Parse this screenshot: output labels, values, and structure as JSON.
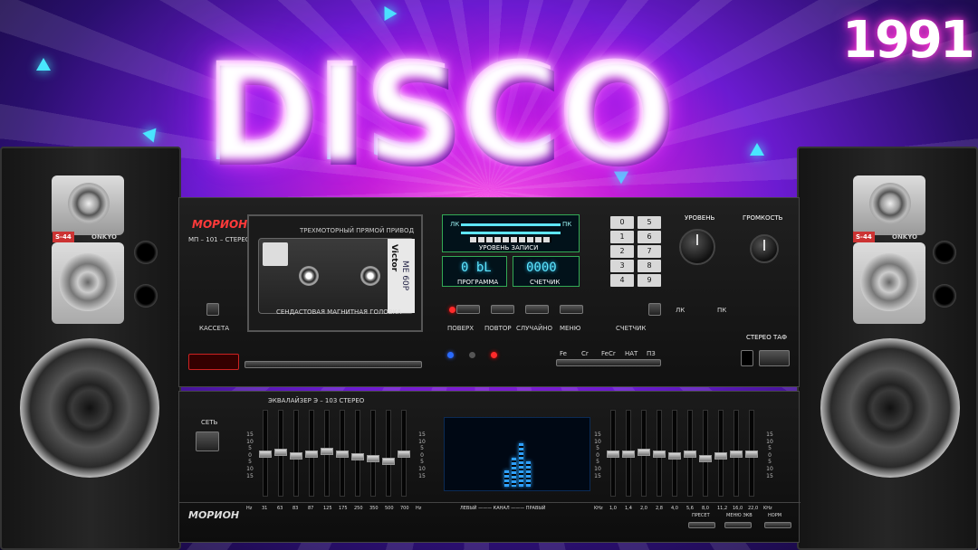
{
  "logo": {
    "text": "1991"
  },
  "headline": {
    "title": "DISCO"
  },
  "deck": {
    "brand": "МОРИОН",
    "model": "МП – 101 – СТЕРЕО",
    "cassette_label": "КАССЕТА",
    "tape_top": "ТРЕХМОТОРНЫЙ ПРЯМОЙ ПРИВОД",
    "cassette_brand": "Victor",
    "cassette_type": "ME 60P",
    "tape_bottom": "СЕНДАСТОВАЯ  МАГНИТНАЯ  ГОЛОВКА",
    "meter_l": "ЛК",
    "meter_r": "ПК",
    "meter_caption": "УРОВЕНЬ ЗАПИСИ",
    "program_value": "0 bL",
    "program_label": "ПРОГРАММА",
    "counter_value": "0000",
    "counter_label": "СЧЕТЧИК",
    "keys": [
      "0",
      "5",
      "1",
      "6",
      "2",
      "7",
      "3",
      "8",
      "4",
      "9"
    ],
    "transport": [
      "ПОВЕРХ",
      "ПОВТОР",
      "СЛУЧАЙНО",
      "МЕНЮ"
    ],
    "counter_btn": "СЧЕТЧИК",
    "level_label": "УРОВЕНЬ",
    "volume_label": "ГРОМКОСТЬ",
    "level_l": "ЛК",
    "level_r": "ПК",
    "stereo": "СТЕРЕО ТАФ",
    "tape_types": [
      "Fe",
      "Cr",
      "FeCr",
      "НАТ",
      "ПЗ"
    ]
  },
  "eq": {
    "title": "ЭКВАЛАЙЗЕР     Э – 103     СТЕРЕО",
    "power": "СЕТЬ",
    "brand": "МОРИОН",
    "scale": [
      "15",
      "10",
      "5",
      "0",
      "5",
      "10",
      "15"
    ],
    "hz_left": [
      "Hz",
      "31",
      "63",
      "83",
      "87",
      "125",
      "175",
      "250",
      "350",
      "500",
      "700",
      "Hz"
    ],
    "channel": "ЛЕВЫЙ  ———  КАНАЛ  ———  ПРАВЫЙ",
    "khz_right": [
      "KHz",
      "1,0",
      "1,4",
      "2,0",
      "2,8",
      "4,0",
      "5,6",
      "8,0",
      "11,2",
      "16,0",
      "22,0",
      "KHz"
    ],
    "btn_preset": "ПРЕСЕТ",
    "btn_menu": "МЕНЮ ЭКВ",
    "btn_norm": "НОРМ",
    "left_levels": [
      0.5,
      0.48,
      0.52,
      0.5,
      0.47,
      0.5,
      0.53,
      0.55,
      0.58,
      0.5
    ],
    "right_levels": [
      0.5,
      0.5,
      0.48,
      0.5,
      0.52,
      0.5,
      0.55,
      0.52,
      0.5,
      0.5
    ]
  },
  "speakers": {
    "left_badge": "S-44",
    "left_brand": "ONKYO",
    "right_badge": "S-44",
    "right_brand": "ONKYO"
  }
}
